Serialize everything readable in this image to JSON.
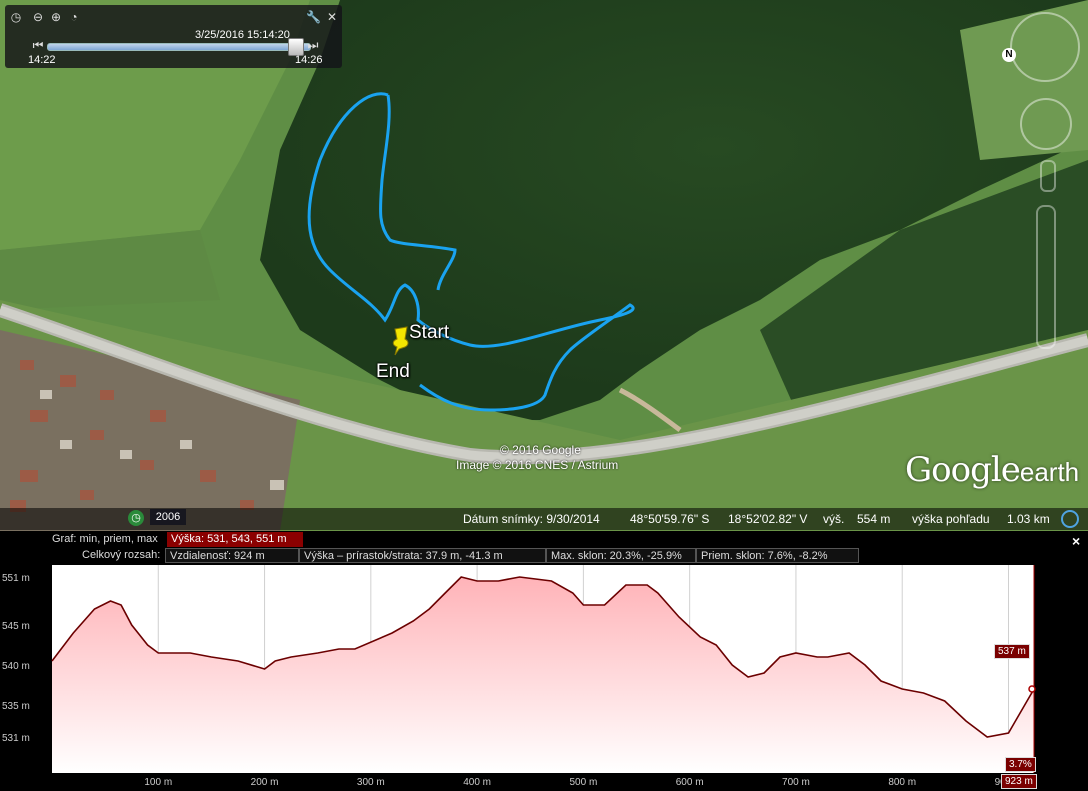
{
  "timeslider": {
    "date_time": "3/25/2016   15:14:20",
    "start_time": "14:22",
    "end_time": "14:26"
  },
  "map": {
    "track_labels": {
      "start": "Start",
      "end": "End"
    },
    "copyright_line1": "© 2016 Google",
    "copyright_line2": "Image © 2016 CNES / Astrium",
    "logo_text": "Google",
    "logo_suffix": "earth",
    "historical_year": "2006",
    "compass_letter": "N"
  },
  "statusbar": {
    "imagery_date": "Dátum snímky: 9/30/2014",
    "latitude": "48°50'59.76\" S",
    "longitude": "18°52'02.82\" V",
    "elevation_label": "výš.",
    "elevation_value": "554 m",
    "eye_alt_label": "výška pohľadu",
    "eye_alt_value": "1.03 km"
  },
  "profile": {
    "graph_label": "Graf: min, priem, max",
    "graph_value": "Výška: 531, 543, 551 m",
    "range_label": "Celkový rozsah:",
    "distance": "Vzdialenosť: 924 m",
    "elevation_gain": "Výška – prírastok/strata: 37.9 m, -41.3 m",
    "max_slope": "Max. sklon: 20.3%, -25.9%",
    "avg_slope": "Priem. sklon: 7.6%, -8.2%",
    "close": "×",
    "cursor_value": "537 m",
    "cursor_slope": "3.7%",
    "cursor_distance": "923 m"
  },
  "colors": {
    "track": "#1aa3f0",
    "profile_line": "#6b0000",
    "profile_fill_top": "#ffb3b8",
    "stat_highlight": "#8b0000"
  },
  "chart_data": {
    "type": "area",
    "x_ticks": [
      "100 m",
      "200 m",
      "300 m",
      "400 m",
      "500 m",
      "600 m",
      "700 m",
      "800 m",
      "900 m"
    ],
    "y_ticks": [
      "551 m",
      "545 m",
      "540 m",
      "535 m",
      "531 m"
    ],
    "xlim": [
      0,
      924
    ],
    "ylim": [
      526.5,
      552.5
    ],
    "series": [
      {
        "x": [
          0,
          20,
          40,
          55,
          65,
          75,
          90,
          100,
          110,
          130,
          150,
          175,
          200,
          210,
          225,
          250,
          270,
          285,
          320,
          340,
          355,
          370,
          385,
          400,
          420,
          440,
          470,
          490,
          500,
          520,
          540,
          560,
          570,
          590,
          610,
          625,
          640,
          655,
          670,
          685,
          700,
          720,
          730,
          750,
          765,
          780,
          800,
          820,
          830,
          840,
          860,
          880,
          900,
          924
        ],
        "y": [
          540.5,
          544,
          547,
          548,
          547.5,
          545,
          542.5,
          541.5,
          541.5,
          541.5,
          541,
          540.5,
          539.5,
          540.5,
          541,
          541.5,
          542,
          542,
          544,
          545.5,
          547,
          549,
          551,
          550.5,
          550.5,
          551,
          550.5,
          549,
          547.5,
          547.5,
          550,
          550,
          549,
          546,
          543.5,
          542.5,
          540,
          538.5,
          539,
          541,
          541.5,
          541,
          541,
          541.5,
          540,
          538,
          537,
          536.5,
          536,
          535.5,
          533,
          531,
          531.5,
          537
        ]
      }
    ]
  }
}
